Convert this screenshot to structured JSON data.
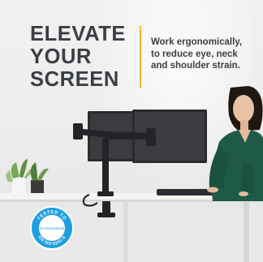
{
  "headline": {
    "lines": [
      "ELEVATE",
      "YOUR",
      "SCREEN"
    ]
  },
  "tagline": {
    "lines": [
      "Work ergonomically,",
      "to reduce eye, neck",
      "and shoulder strain."
    ]
  },
  "badge": {
    "top_text": "TESTED TO",
    "center_text": "tuv international",
    "bottom_text": "EN ISO 9241-5"
  },
  "colors": {
    "headline_text": "#3b3f44",
    "divider_accent": "#f2b624",
    "badge_blue": "#1e9ee0",
    "monitor_frame": "#2a2b2e",
    "blazer_green": "#1f5a47",
    "desk_top": "#f4f4f2"
  },
  "icons": {
    "badge": "certification-seal-icon"
  }
}
